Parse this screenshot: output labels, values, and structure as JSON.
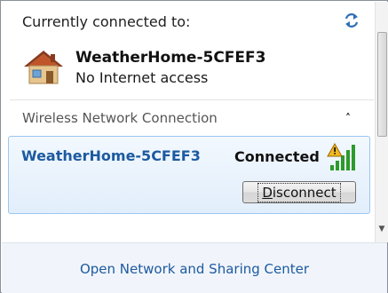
{
  "header": {
    "title": "Currently connected to:"
  },
  "current_connection": {
    "name": "WeatherHome-5CFEF3",
    "status": "No Internet access"
  },
  "section": {
    "label": "Wireless Network Connection"
  },
  "network_item": {
    "name": "WeatherHome-5CFEF3",
    "status": "Connected",
    "button_label": "Disconnect",
    "button_mnemonic": "D",
    "button_rest": "isconnect"
  },
  "footer": {
    "link_label": "Open Network and Sharing Center"
  },
  "icons": {
    "refresh": "refresh-icon",
    "network": "home-network-icon",
    "collapse": "chevron-up-icon",
    "signal": "wifi-signal-warning-icon"
  },
  "colors": {
    "link": "#1d5aa0",
    "selection_border": "#9ac7ef",
    "selection_bg": "#e2eefb",
    "footer_bg": "#f1f5fb"
  }
}
